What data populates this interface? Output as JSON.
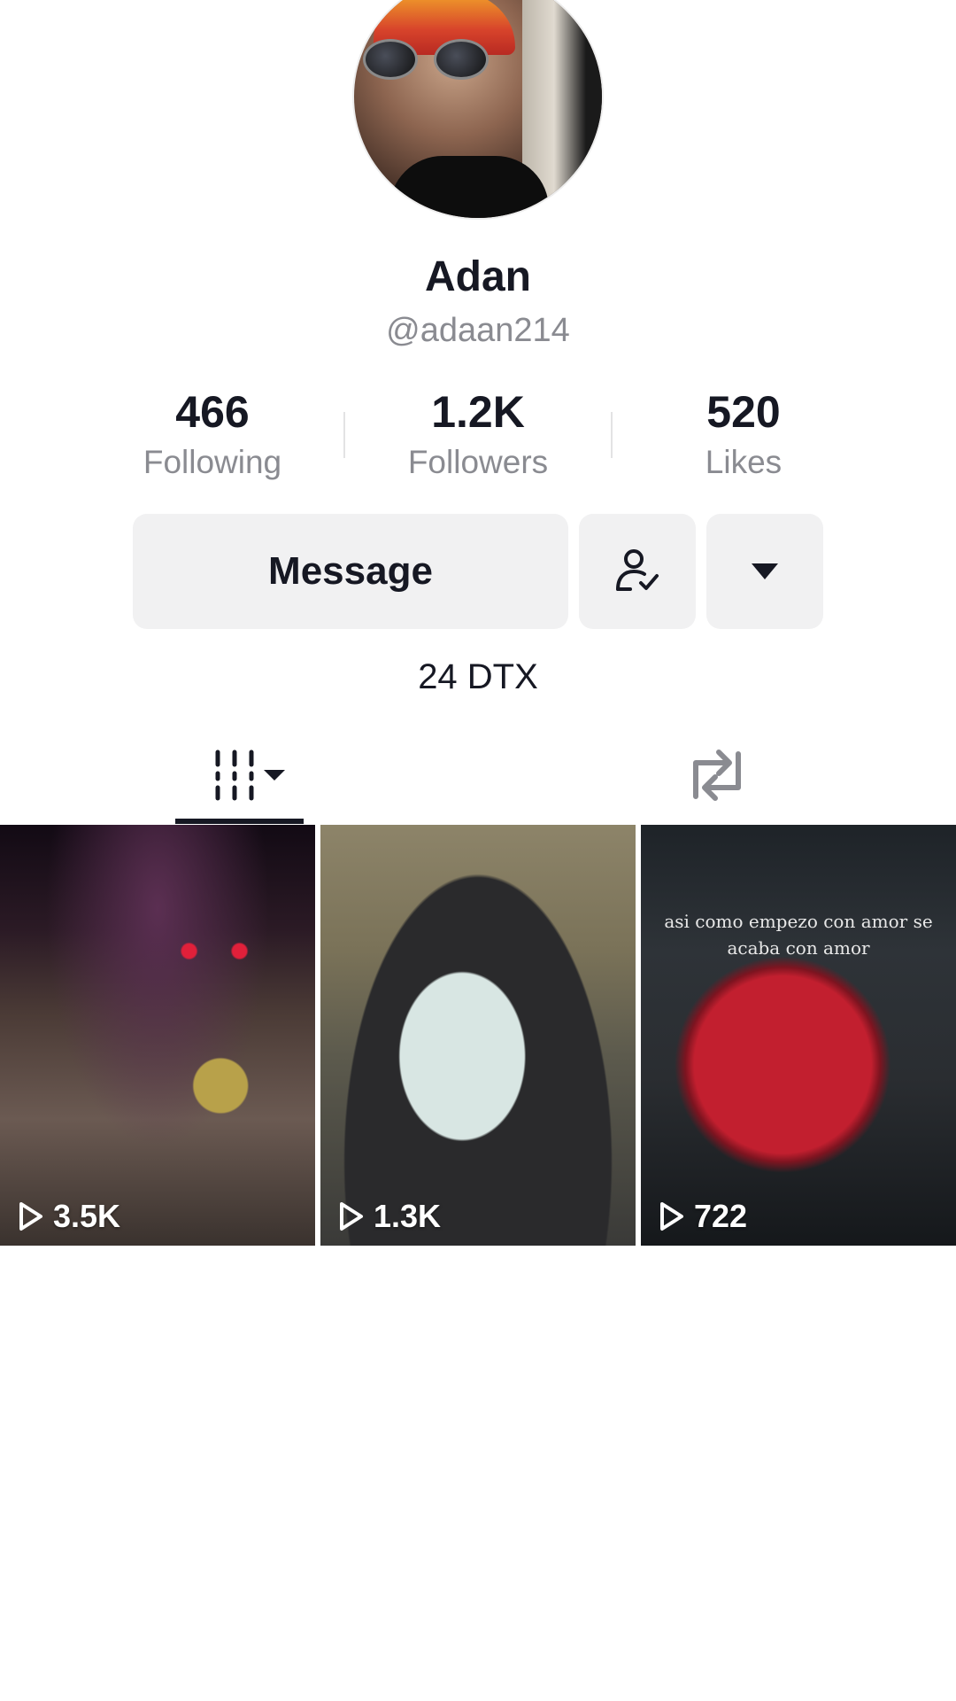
{
  "profile": {
    "name": "Adan",
    "handle": "@adaan214",
    "dtx": "24 DTX"
  },
  "stats": [
    {
      "value": "466",
      "label": "Following"
    },
    {
      "value": "1.2K",
      "label": "Followers"
    },
    {
      "value": "520",
      "label": "Likes"
    }
  ],
  "actions": {
    "message_label": "Message",
    "follow_icon": "user-check-icon",
    "more_icon": "caret-down-icon"
  },
  "tabs": [
    {
      "icon": "videos-grid-icon",
      "active": true
    },
    {
      "icon": "repost-icon",
      "active": false
    }
  ],
  "videos": [
    {
      "views": "3.5K"
    },
    {
      "views": "1.3K"
    },
    {
      "views": "722",
      "overlay_text": "asi como empezo con amor se acaba con amor"
    }
  ],
  "colors": {
    "text": "#161823",
    "secondary_text": "#8a8b91",
    "button_bg": "#f1f1f2"
  }
}
